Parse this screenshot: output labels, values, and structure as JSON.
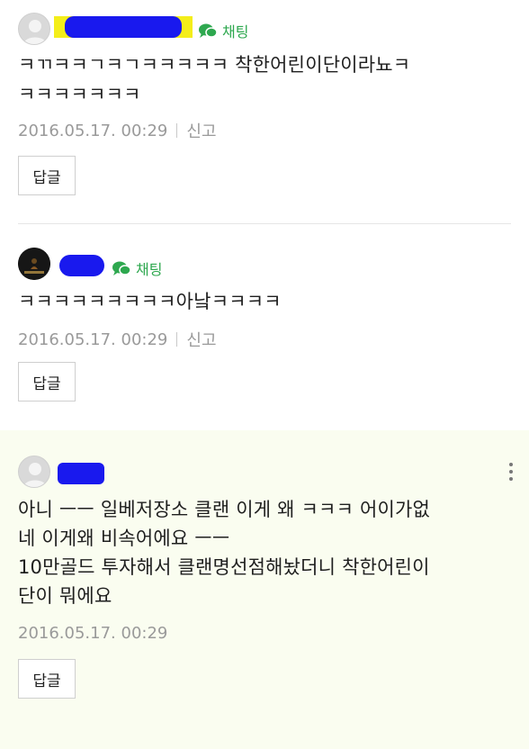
{
  "comments": [
    {
      "chat_label": "채팅",
      "body": "ㅋㄲㅋㅋㄱㅋㄱㅋㅋㅋㅋㅋ 착한어린이단이라뇨ㅋ\nㅋㅋㅋㅋㅋㅋㅋ",
      "date": "2016.05.17. 00:29",
      "report_label": "신고",
      "reply_label": "답글"
    },
    {
      "chat_label": "채팅",
      "body": "ㅋㅋㅋㅋㅋㅋㅋㅋㅋ아낰ㅋㅋㅋㅋ",
      "date": "2016.05.17. 00:29",
      "report_label": "신고",
      "reply_label": "답글"
    },
    {
      "body": "아니 ㅡㅡ 일베저장소 클랜 이게 왜 ㅋㅋㅋ 어이가없\n네 이게왜 비속어에요 ㅡㅡ\n10만골드 투자해서 클랜명선점해놨더니 착한어린이\n단이 뭐에요",
      "date": "2016.05.17. 00:29",
      "reply_label": "답글"
    }
  ],
  "icons": {
    "chat": "chat-bubble-icon",
    "more": "more-vertical-icon",
    "avatar": "default-avatar-icon"
  },
  "colors": {
    "chat_green": "#2ea84f",
    "highlight_bg": "#fafdf0",
    "redaction_blue": "#1919ee",
    "redaction_yellow": "#f4ee1a"
  }
}
